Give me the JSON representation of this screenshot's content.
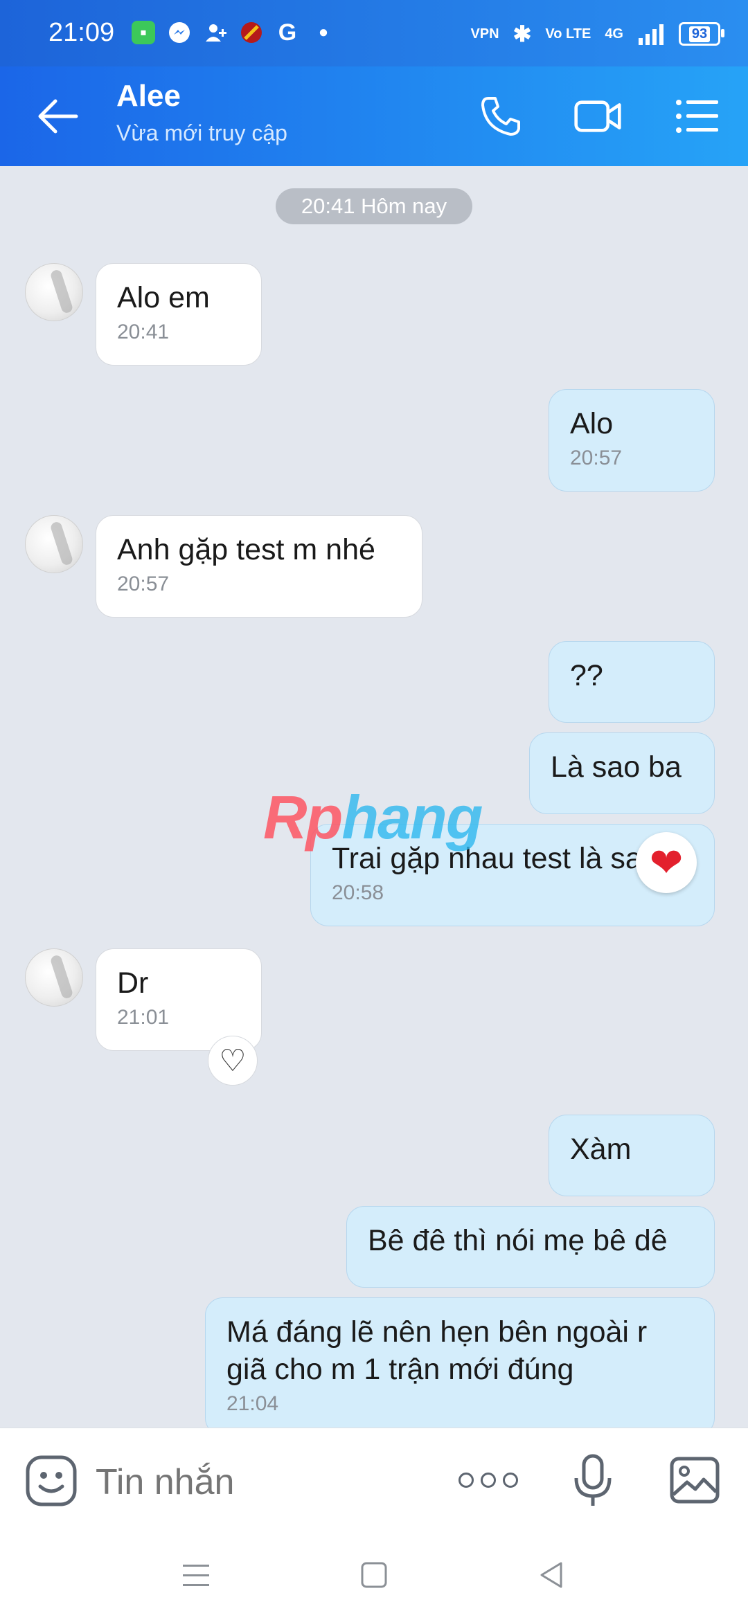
{
  "status_bar": {
    "time": "21:09",
    "left_icons": [
      "messages-icon",
      "messenger-icon",
      "add-contact-icon",
      "app-icon",
      "google-icon",
      "dot-icon"
    ],
    "right_labels": {
      "vpn": "VPN",
      "volte": "Vo LTE",
      "network": "4G"
    },
    "battery": "93"
  },
  "header": {
    "name": "Alee",
    "status": "Vừa mới truy cập",
    "accent_from": "#1b66e8",
    "accent_to": "#26a3f7"
  },
  "chat": {
    "date_chip": "20:41 Hôm nay",
    "messages": [
      {
        "dir": "in",
        "text": "Alo em",
        "time": "20:41"
      },
      {
        "dir": "out",
        "text": "Alo",
        "time": "20:57"
      },
      {
        "dir": "in",
        "text": "Anh gặp test m nhé",
        "time": "20:57"
      },
      {
        "dir": "out",
        "text": "??",
        "time": ""
      },
      {
        "dir": "out",
        "text": "Là sao ba",
        "time": ""
      },
      {
        "dir": "out",
        "text": "Trai gặp nhau test là sao",
        "time": "20:58",
        "reaction": "❤"
      },
      {
        "dir": "in",
        "text": "Dr",
        "time": "21:01",
        "reaction": "♡"
      },
      {
        "dir": "out",
        "text": "Xàm",
        "time": ""
      },
      {
        "dir": "out",
        "text": "Bê đê thì nói mẹ bê dê",
        "time": ""
      },
      {
        "dir": "out",
        "text_line1": "Má đáng lẽ nên hẹn bên ngoài r",
        "text_line2": "giã cho m 1 trận mới đúng",
        "time": "21:04"
      }
    ],
    "watermark_a": "Rp",
    "watermark_b": "hang"
  },
  "composer": {
    "placeholder": "Tin nhắn"
  }
}
